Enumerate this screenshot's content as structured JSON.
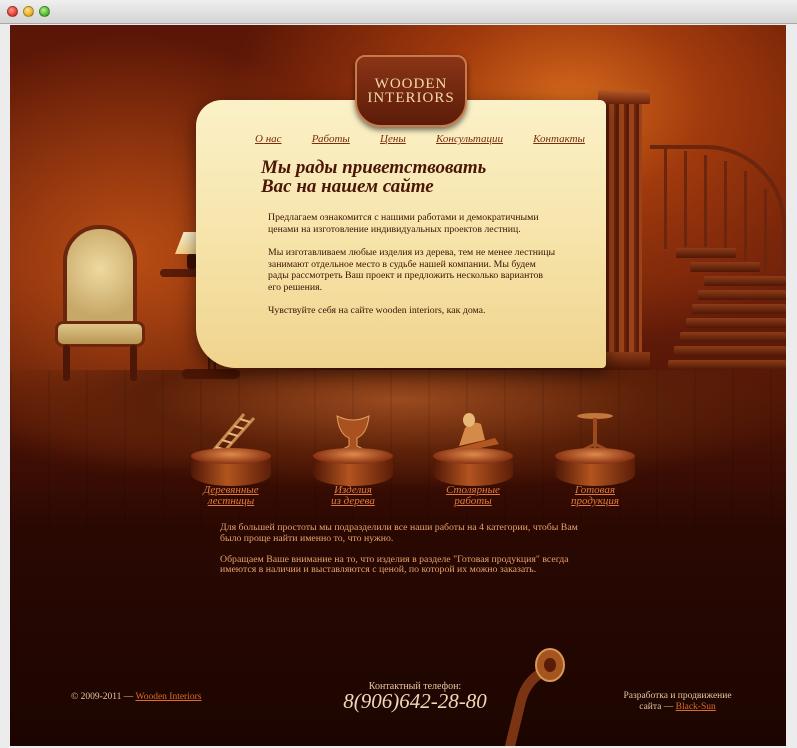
{
  "site": {
    "logo_line1": "WOODEN",
    "logo_line2": "INTERIORS"
  },
  "nav": [
    {
      "label": "О нас"
    },
    {
      "label": "Работы"
    },
    {
      "label": "Цены"
    },
    {
      "label": "Консультации"
    },
    {
      "label": "Контакты"
    }
  ],
  "welcome": {
    "title_line1": "Мы рады приветствовать",
    "title_line2": "Вас на нашем сайте",
    "paragraphs": [
      "Предлагаем ознакомится с нашими работами и демократичными ценами на изготовление индивидуальных проектов лестниц.",
      "Мы изготавливаем любые изделия из дерева, тем не менее лестницы занимают отдельное место в судьбе нашей компании. Мы будем рады рассмотреть Ваш проект и предложить несколько вариантов его решения.",
      "Чувствуйте себя на сайте wooden interiors, как дома."
    ]
  },
  "categories": [
    {
      "line1": "Деревянные",
      "line2": "лестницы",
      "icon": "stairs-icon"
    },
    {
      "line1": "Изделия",
      "line2": "из дерева",
      "icon": "vase-icon"
    },
    {
      "line1": "Столярные",
      "line2": "работы",
      "icon": "plane-tool-icon"
    },
    {
      "line1": "Готовая",
      "line2": "продукция",
      "icon": "table-icon"
    }
  ],
  "info": [
    "Для большей простоты мы подразделили все наши работы на 4 категории, чтобы Вам было проще найти именно то, что нужно.",
    "Обращаем Ваше внимание на то, что изделия в разделе \"Готовая продукция\" всегда имеются в наличии и выставляются с ценой, по которой их можно заказать."
  ],
  "footer": {
    "copyright_prefix": "© 2009-2011 — ",
    "copyright_link": "Wooden Interiors",
    "phone_label": "Контактный телефон:",
    "phone": "8(906)642-28-80",
    "dev_prefix_line1": "Разработка и продвижение",
    "dev_prefix_line2": "сайта — ",
    "dev_link": "Black-Sun"
  },
  "colors": {
    "background_dark": "#2a0802",
    "panel": "#f6e3a8",
    "link": "#e07a3e",
    "nav_link": "#7a2c0c"
  }
}
